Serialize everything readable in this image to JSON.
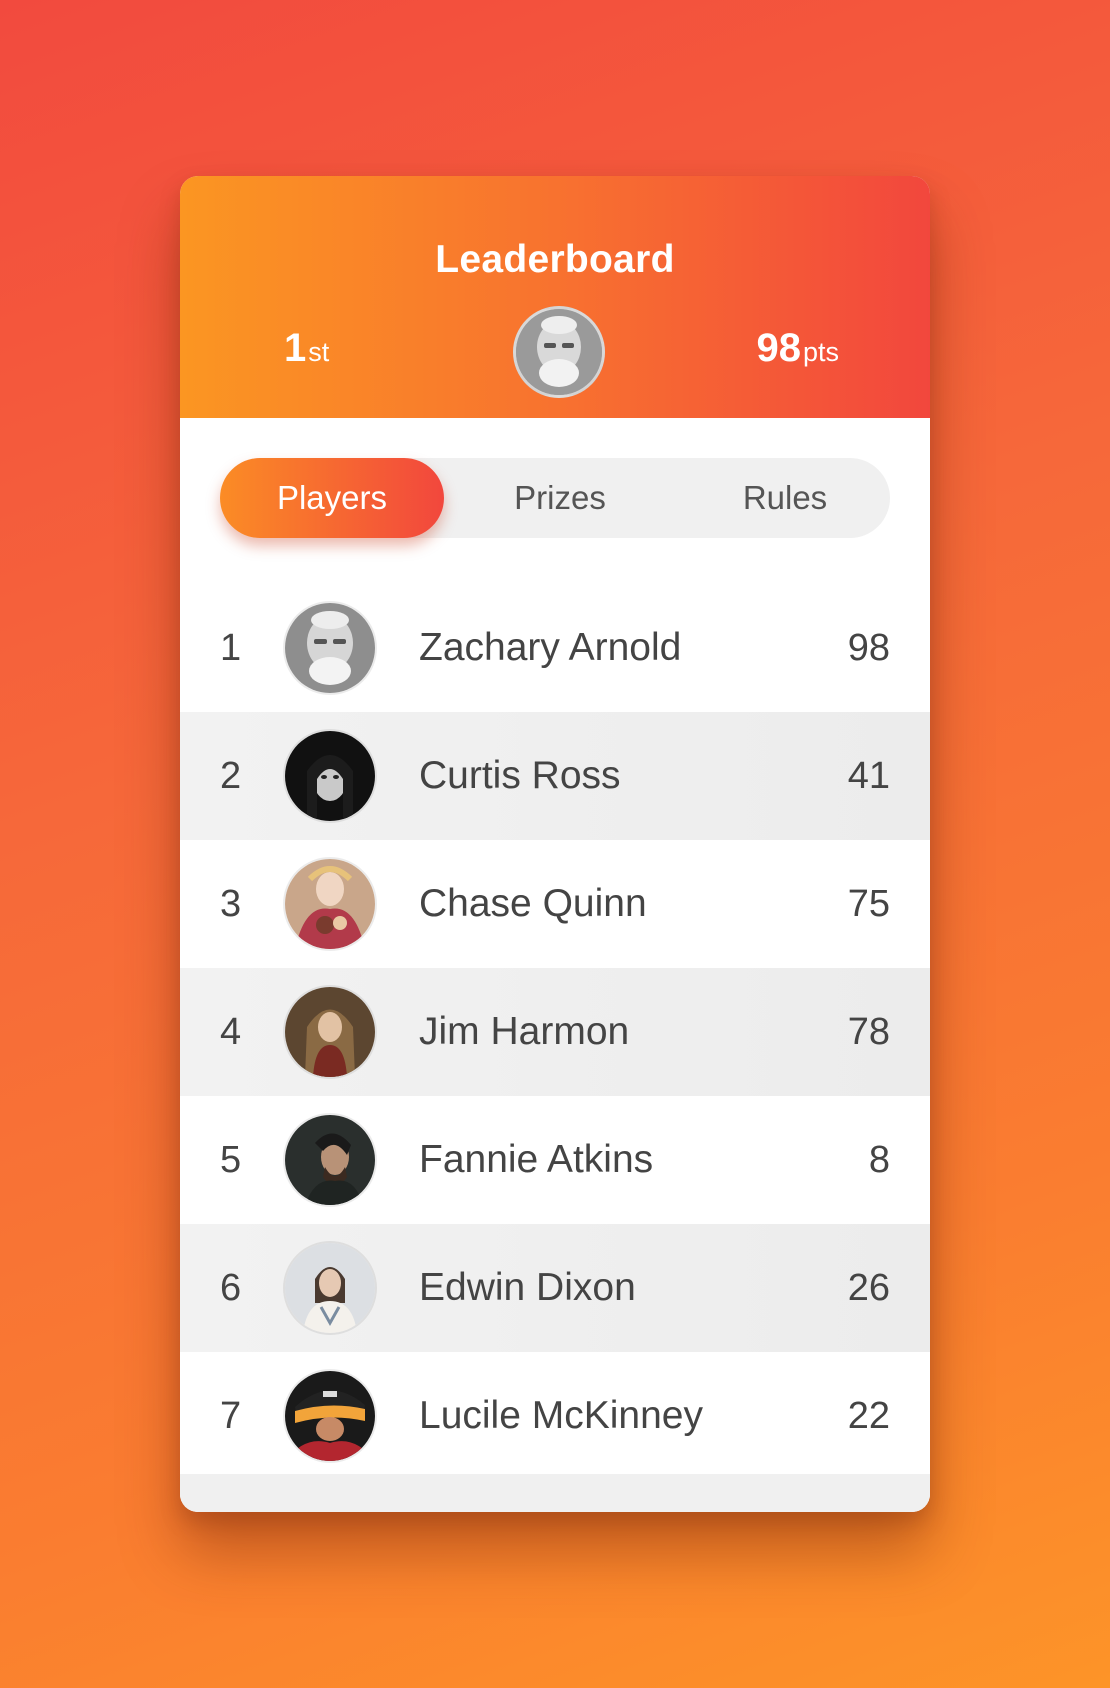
{
  "header": {
    "title": "Leaderboard",
    "rank_number": "1",
    "rank_suffix": "st",
    "points_number": "98",
    "points_suffix": "pts"
  },
  "tabs": [
    {
      "label": "Players",
      "active": true
    },
    {
      "label": "Prizes",
      "active": false
    },
    {
      "label": "Rules",
      "active": false
    }
  ],
  "players": [
    {
      "rank": "1",
      "name": "Zachary Arnold",
      "score": "98"
    },
    {
      "rank": "2",
      "name": "Curtis Ross",
      "score": "41"
    },
    {
      "rank": "3",
      "name": "Chase Quinn",
      "score": "75"
    },
    {
      "rank": "4",
      "name": "Jim Harmon",
      "score": "78"
    },
    {
      "rank": "5",
      "name": "Fannie Atkins",
      "score": "8"
    },
    {
      "rank": "6",
      "name": "Edwin Dixon",
      "score": "26"
    },
    {
      "rank": "7",
      "name": "Lucile McKinney",
      "score": "22"
    }
  ],
  "colors": {
    "accent_start": "#fb9622",
    "accent_end": "#f2473d",
    "text": "#444444"
  }
}
